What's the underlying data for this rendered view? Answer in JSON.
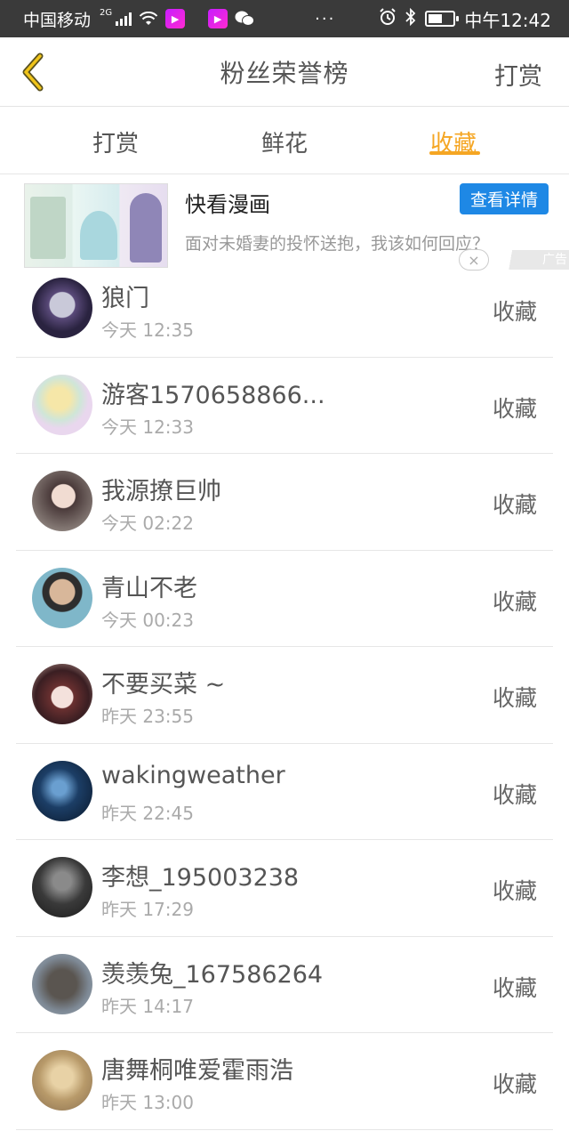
{
  "status_bar": {
    "carrier": "中国移动",
    "network": "2G",
    "dots": "···",
    "time": "中午12:42",
    "battery_level": 0.55
  },
  "header": {
    "title": "粉丝荣誉榜",
    "action_label": "打赏"
  },
  "tabs": [
    {
      "label": "打赏",
      "active": false
    },
    {
      "label": "鲜花",
      "active": false
    },
    {
      "label": "收藏",
      "active": true
    }
  ],
  "ad": {
    "name": "快看漫画",
    "button_label": "查看详情",
    "description": "面对未婚妻的投怀送抱，我该如何回应？",
    "close_glyph": "×",
    "label": "广告"
  },
  "colors": {
    "accent": "#f5a623",
    "ad_button": "#1e88e5",
    "status_bar_bg": "#3a3a3a"
  },
  "list": [
    {
      "name": "狼门",
      "time": "今天 12:35",
      "action": "收藏",
      "avatar": "dark-purple"
    },
    {
      "name": "游客1570658866...",
      "time": "今天 12:33",
      "action": "收藏",
      "avatar": "pastel-anime"
    },
    {
      "name": "我源撩巨帅",
      "time": "今天 02:22",
      "action": "收藏",
      "avatar": "portrait-woman"
    },
    {
      "name": "青山不老",
      "time": "今天 00:23",
      "action": "收藏",
      "avatar": "portrait-man"
    },
    {
      "name": "不要买菜 ~",
      "time": "昨天 23:55",
      "action": "收藏",
      "avatar": "anime-girl"
    },
    {
      "name": "wakingweather",
      "time": "昨天 22:45",
      "action": "收藏",
      "avatar": "blue-night"
    },
    {
      "name": "李想_195003238",
      "time": "昨天 17:29",
      "action": "收藏",
      "avatar": "dark-gray"
    },
    {
      "name": "羡羡兔_167586264",
      "time": "昨天 14:17",
      "action": "收藏",
      "avatar": "gray-blue"
    },
    {
      "name": "唐舞桐唯爱霍雨浩",
      "time": "昨天 13:00",
      "action": "收藏",
      "avatar": "warm-beige"
    }
  ]
}
